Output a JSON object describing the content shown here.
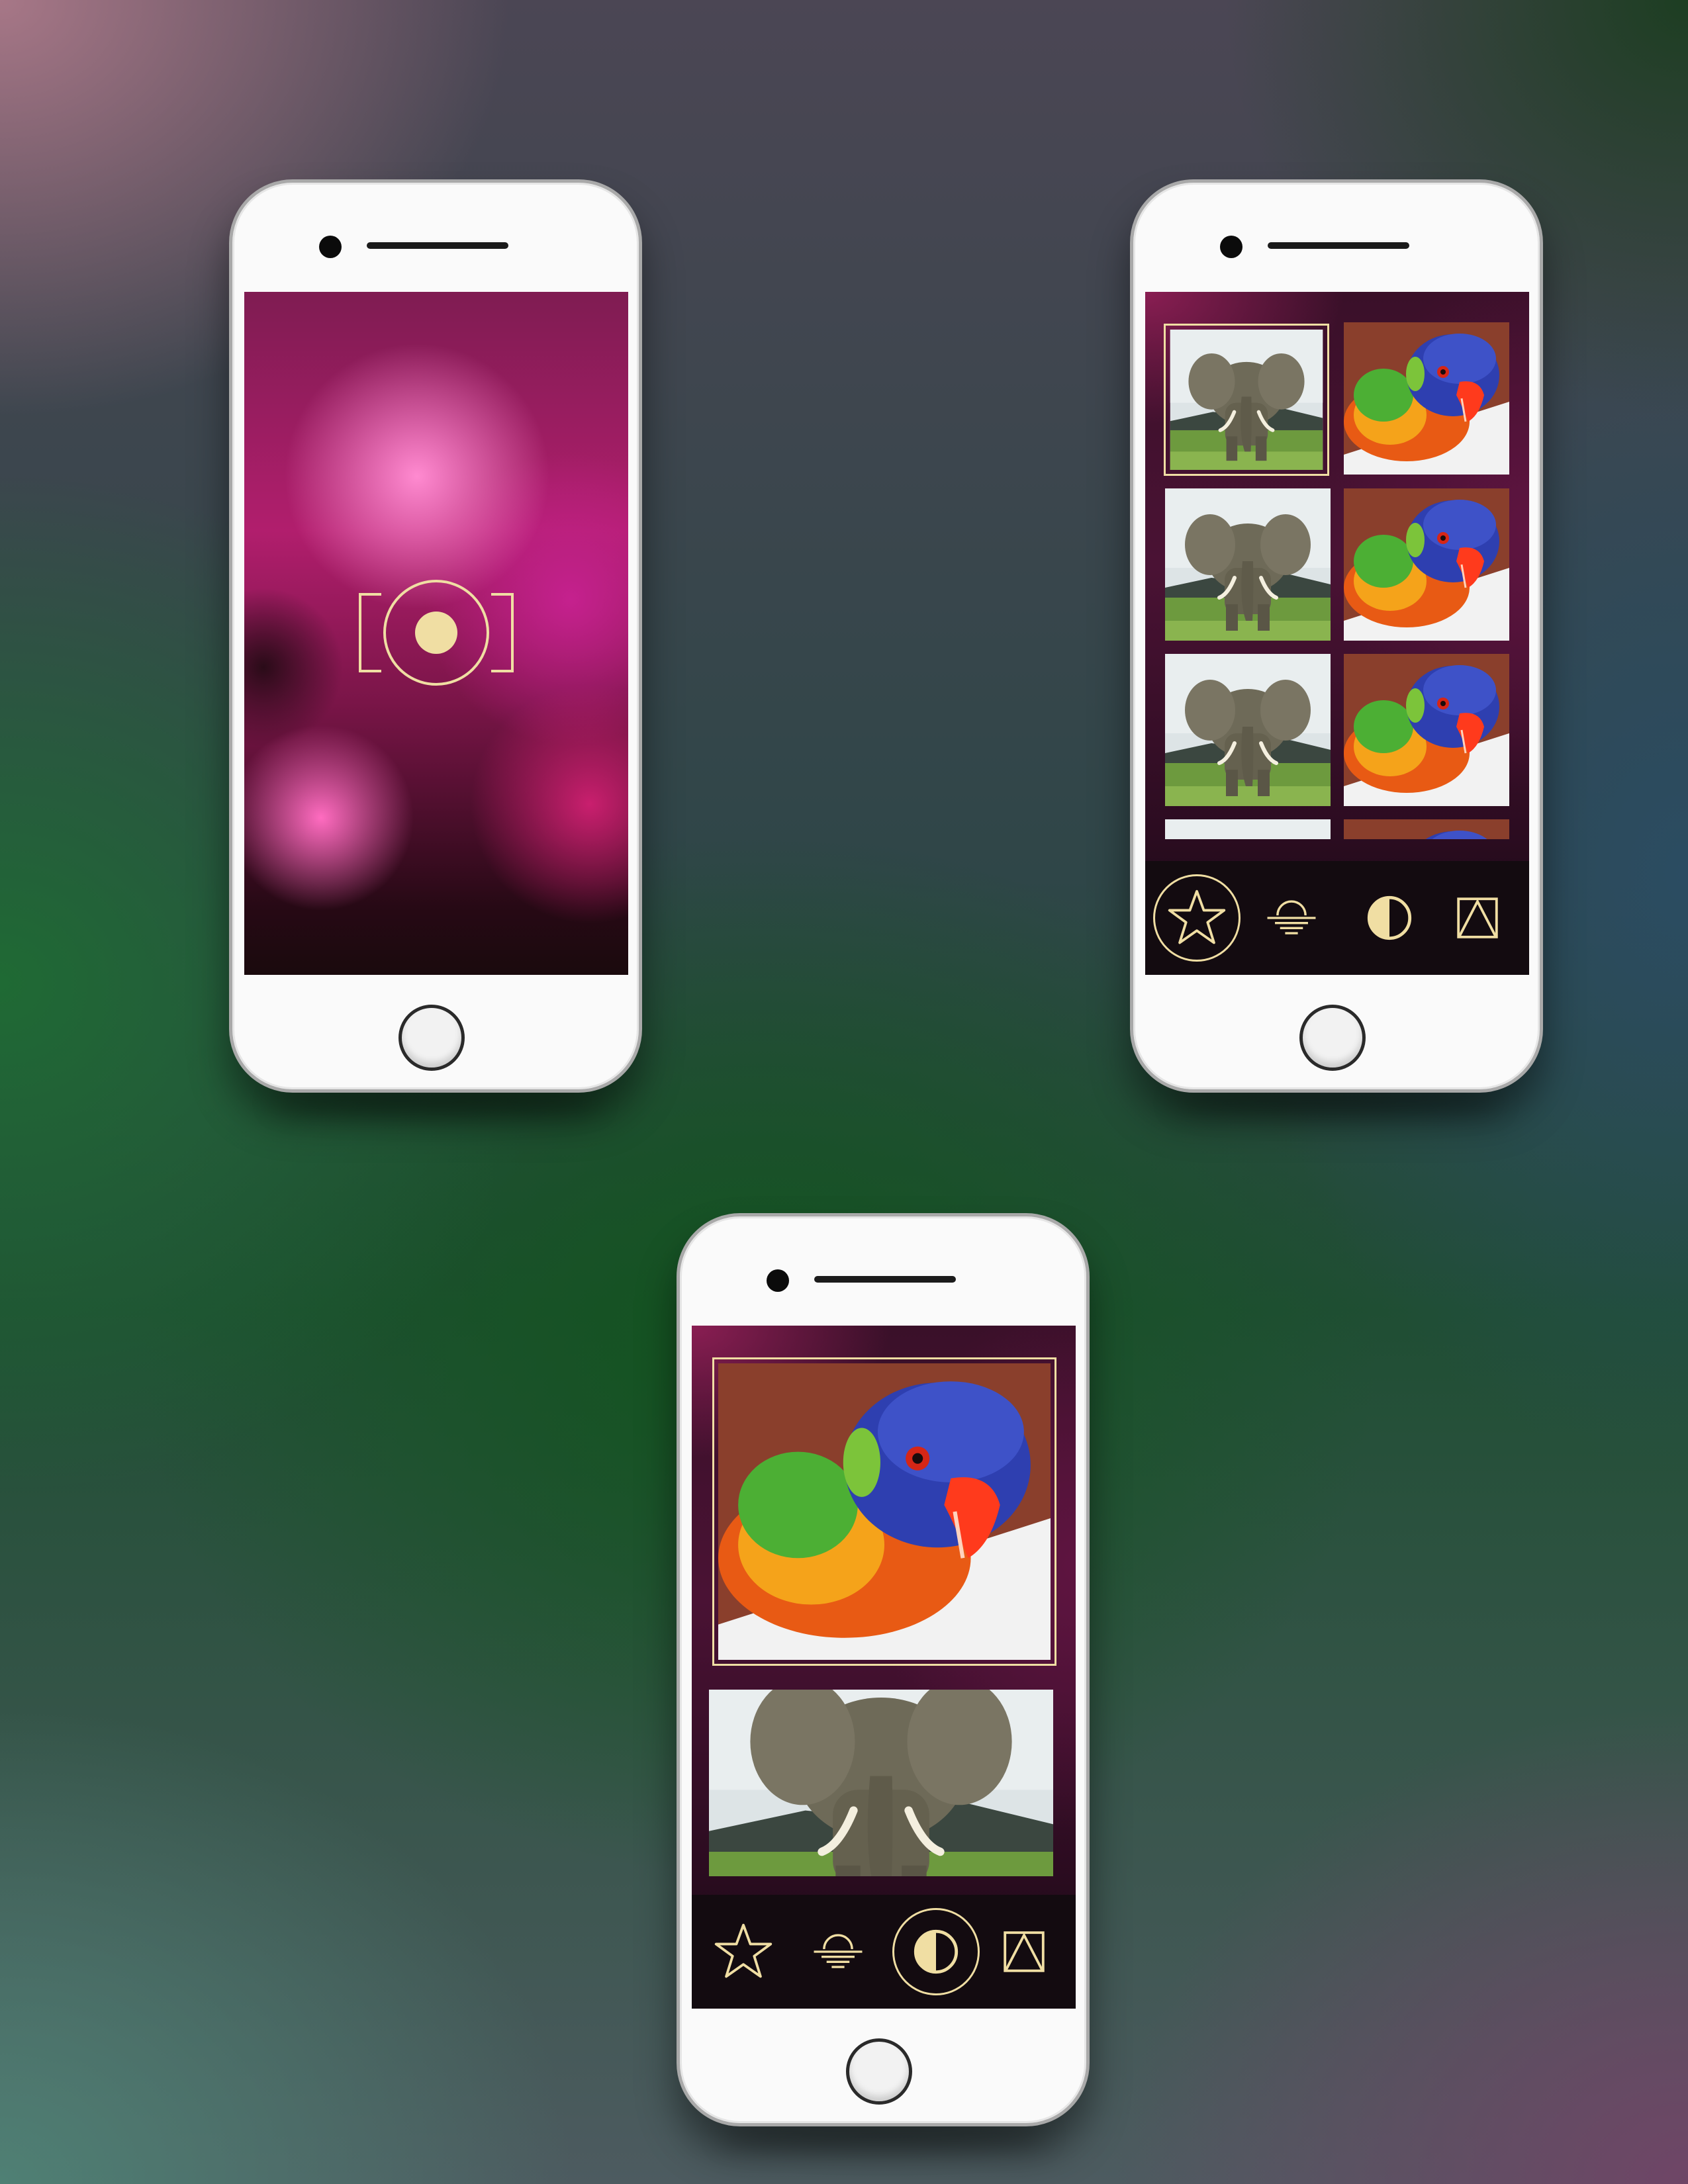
{
  "phones": [
    {
      "id": "camera",
      "screen": {
        "center_icon": "camera-icon"
      }
    },
    {
      "id": "gallery",
      "thumbnails": [
        {
          "subject": "elephant",
          "selected": true
        },
        {
          "subject": "parrot",
          "selected": false
        },
        {
          "subject": "elephant",
          "selected": false
        },
        {
          "subject": "parrot",
          "selected": false
        },
        {
          "subject": "elephant",
          "selected": false
        },
        {
          "subject": "parrot",
          "selected": false
        }
      ],
      "toolbar": [
        "star-icon",
        "horizon-icon",
        "contrast-icon",
        "mountain-triangle-icon"
      ],
      "active_tool": "star-icon"
    },
    {
      "id": "detail",
      "photos": [
        {
          "subject": "parrot",
          "selected": true
        },
        {
          "subject": "elephant",
          "selected": false
        }
      ],
      "toolbar": [
        "star-icon",
        "horizon-icon",
        "contrast-icon",
        "mountain-triangle-icon"
      ],
      "active_tool": "contrast-icon"
    }
  ],
  "colors": {
    "accent": "#f0dea3",
    "toolbar_bg": "#130b10"
  }
}
